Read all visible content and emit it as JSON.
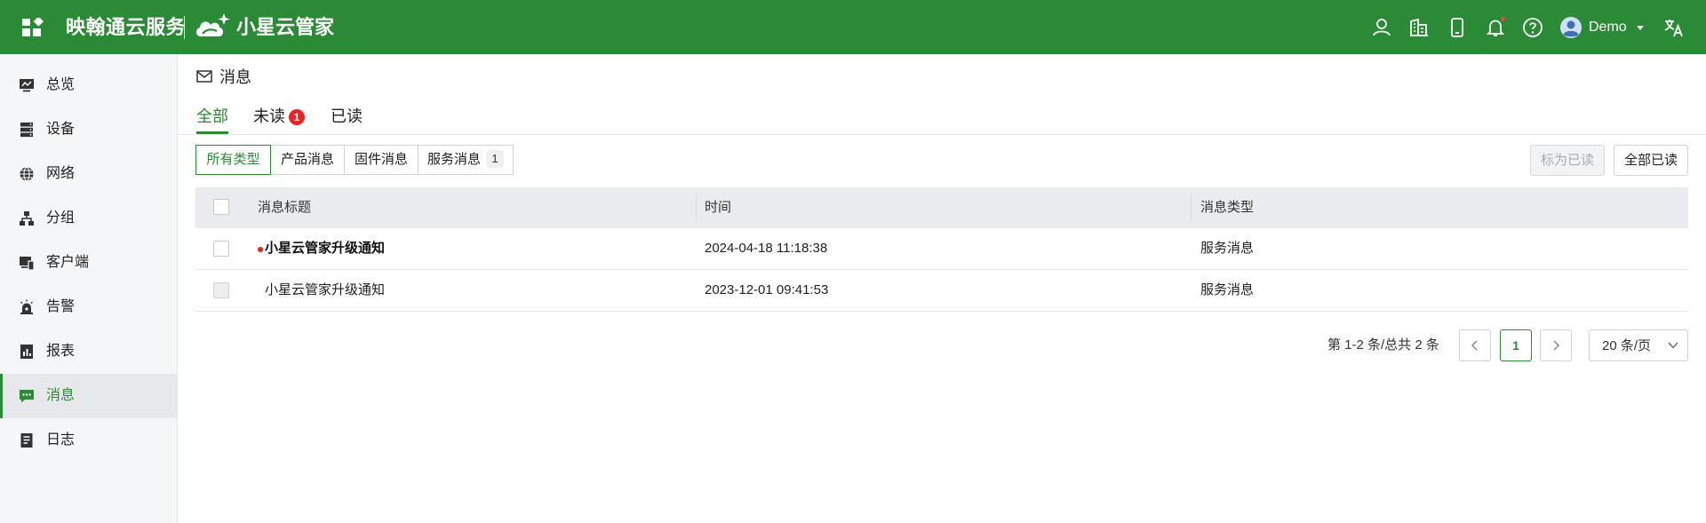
{
  "header": {
    "brand": "映翰通云服务",
    "product": "小星云管家",
    "user": "Demo",
    "icons": [
      "apps-grid-icon",
      "user-icon",
      "building-icon",
      "mobile-icon",
      "bell-icon",
      "help-icon",
      "avatar-icon",
      "translate-icon"
    ],
    "accent": "#2b8a36",
    "notification_dot_color": "#ff3b30"
  },
  "sidebar": {
    "items": [
      {
        "label": "总览",
        "icon": "monitor-icon"
      },
      {
        "label": "设备",
        "icon": "server-icon"
      },
      {
        "label": "网络",
        "icon": "globe-icon"
      },
      {
        "label": "分组",
        "icon": "hierarchy-icon"
      },
      {
        "label": "客户端",
        "icon": "devices-icon"
      },
      {
        "label": "告警",
        "icon": "alarm-icon"
      },
      {
        "label": "报表",
        "icon": "report-icon"
      },
      {
        "label": "消息",
        "icon": "message-icon"
      },
      {
        "label": "日志",
        "icon": "log-icon"
      }
    ],
    "active": "消息"
  },
  "page": {
    "title": "消息",
    "tabs": [
      {
        "label": "全部"
      },
      {
        "label": "未读",
        "badge": "1"
      },
      {
        "label": "已读"
      }
    ],
    "active_tab": "全部",
    "type_filters": [
      {
        "label": "所有类型"
      },
      {
        "label": "产品消息"
      },
      {
        "label": "固件消息"
      },
      {
        "label": "服务消息",
        "count": "1"
      }
    ],
    "active_filter": "所有类型",
    "actions": {
      "mark_read": "标为已读",
      "mark_all_read": "全部已读"
    }
  },
  "table": {
    "columns": [
      "消息标题",
      "时间",
      "消息类型"
    ],
    "rows": [
      {
        "title": "小星云管家升级通知",
        "time": "2024-04-18 11:18:38",
        "type": "服务消息",
        "unread": true
      },
      {
        "title": "小星云管家升级通知",
        "time": "2023-12-01 09:41:53",
        "type": "服务消息",
        "unread": false
      }
    ]
  },
  "pagination": {
    "summary": "第 1-2 条/总共 2 条",
    "current_page": "1",
    "page_size": "20 条/页"
  }
}
